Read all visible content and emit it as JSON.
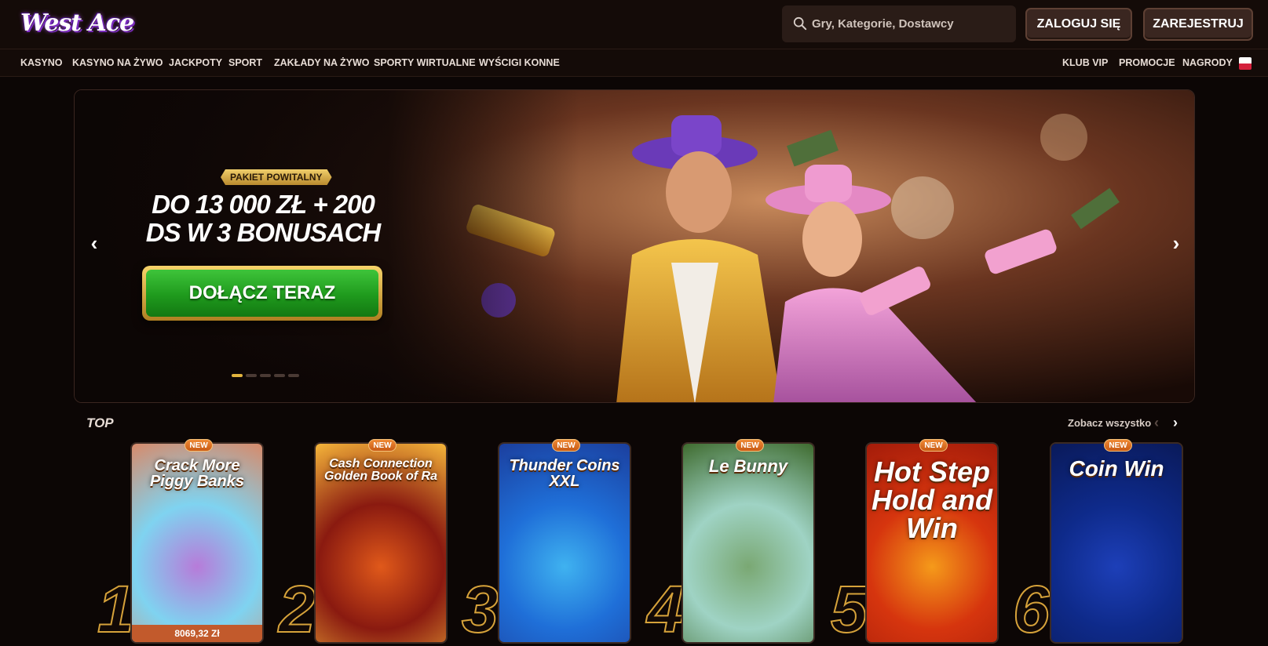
{
  "header": {
    "logo_text": "West Ace",
    "search": {
      "placeholder": "Gry, Kategorie, Dostawcy"
    },
    "login_label": "ZALOGUJ SIĘ",
    "register_label": "ZAREJESTRUJ"
  },
  "nav": {
    "left": [
      "KASYNO",
      "KASYNO NA ŻYWO",
      "JACKPOTY",
      "SPORT",
      "ZAKŁADY NA ŻYWO",
      "SPORTY WIRTUALNE",
      "WYŚCIGI KONNE"
    ],
    "right": [
      "KLUB VIP",
      "PROMOCJE",
      "NAGRODY"
    ],
    "language_flag": "poland-flag-icon"
  },
  "banner": {
    "badge": "PAKIET POWITALNY",
    "headline_line1": "DO 13 000 ZŁ + 200",
    "headline_line2": "DS W 3 BONUSACH",
    "cta_label": "DOŁĄCZ TERAZ",
    "slide_count": 5,
    "active_slide": 1
  },
  "top_section": {
    "title": "TOP",
    "see_all_label": "Zobacz wszystko",
    "new_tag": "NEW",
    "games": [
      {
        "rank": "1",
        "name": "Crack More Piggy Banks",
        "amount": "8069,32 Zł",
        "colors": [
          "#7fd3f0",
          "#b77bd9",
          "#d88a6a"
        ]
      },
      {
        "rank": "2",
        "name": "Cash Connection Golden Book of Ra",
        "colors": [
          "#8a1a10",
          "#e0591a",
          "#f5b53a"
        ]
      },
      {
        "rank": "3",
        "name": "Thunder Coins XXL",
        "colors": [
          "#1f6fd8",
          "#3fb2f0",
          "#1b3f9e"
        ]
      },
      {
        "rank": "4",
        "name": "Le Bunny",
        "colors": [
          "#9fd3c4",
          "#7aa873",
          "#3f6b2f"
        ]
      },
      {
        "rank": "5",
        "name": "Hot Step Hold and Win",
        "colors": [
          "#d6350e",
          "#f59a1a",
          "#a41c0a"
        ]
      },
      {
        "rank": "6",
        "name": "Coin Win",
        "colors": [
          "#0e2a8a",
          "#1d3fb8",
          "#0a1a5a"
        ]
      }
    ]
  },
  "colors": {
    "background": "#0c0605",
    "header": "#140b08",
    "accent_gold": "#e2b43e",
    "cta_green": "#1f9a1d"
  }
}
